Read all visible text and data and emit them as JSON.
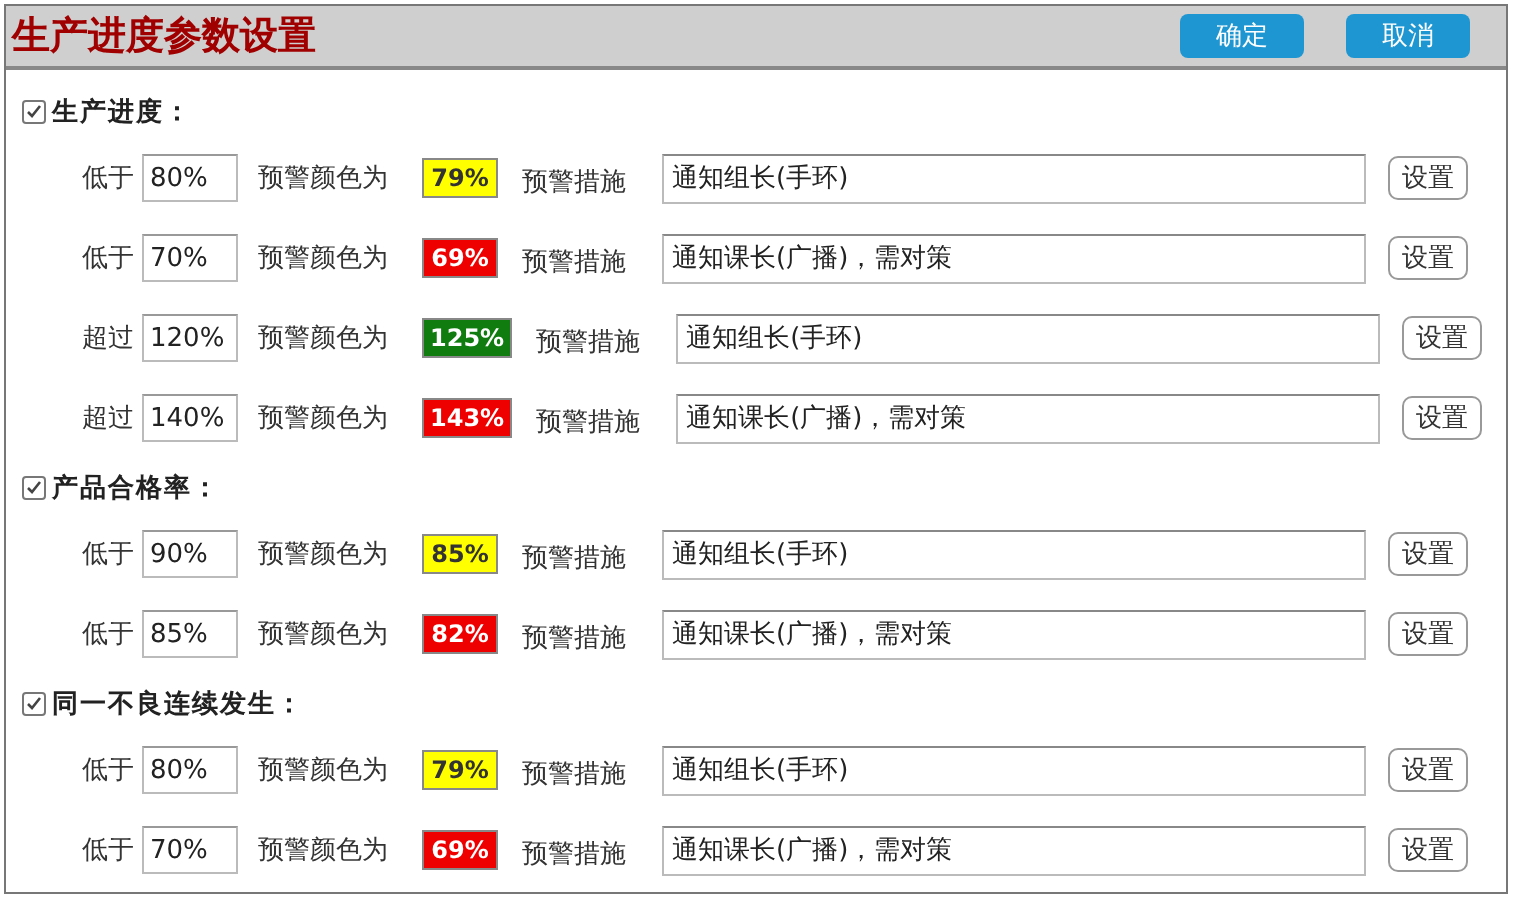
{
  "window": {
    "title": "生产进度参数设置",
    "buttons": [
      "确定",
      "取消"
    ]
  },
  "sections": [
    {
      "title": "生产进度：",
      "checked": true,
      "rules": [
        {
          "condition": "低于",
          "threshold": "80%",
          "color_label": "预警颜色为",
          "sample": "79%",
          "color": "#ffff00",
          "action_label": "预警措施",
          "action": "通知组长(手环)",
          "button": "设置"
        },
        {
          "condition": "低于",
          "threshold": "70%",
          "color_label": "预警颜色为",
          "sample": "69%",
          "color": "#ee0000",
          "action_label": "预警措施",
          "action": "通知课长(广播)，需对策",
          "button": "设置"
        },
        {
          "condition": "超过",
          "threshold": "120%",
          "color_label": "预警颜色为",
          "sample": "125%",
          "color": "#107c10",
          "action_label": "预警措施",
          "action": "通知组长(手环)",
          "button": "设置"
        },
        {
          "condition": "超过",
          "threshold": "140%",
          "color_label": "预警颜色为",
          "sample": "143%",
          "color": "#ee0000",
          "action_label": "预警措施",
          "action": "通知课长(广播)，需对策",
          "button": "设置"
        }
      ]
    },
    {
      "title": "产品合格率：",
      "checked": true,
      "rules": [
        {
          "condition": "低于",
          "threshold": "90%",
          "color_label": "预警颜色为",
          "sample": "85%",
          "color": "#ffff00",
          "action_label": "预警措施",
          "action": "通知组长(手环)",
          "button": "设置"
        },
        {
          "condition": "低于",
          "threshold": "85%",
          "color_label": "预警颜色为",
          "sample": "82%",
          "color": "#ee0000",
          "action_label": "预警措施",
          "action": "通知课长(广播)，需对策",
          "button": "设置"
        }
      ]
    },
    {
      "title": "同一不良连续发生：",
      "checked": true,
      "rules": [
        {
          "condition": "低于",
          "threshold": "80%",
          "color_label": "预警颜色为",
          "sample": "79%",
          "color": "#ffff00",
          "action_label": "预警措施",
          "action": "通知组长(手环)",
          "button": "设置"
        },
        {
          "condition": "低于",
          "threshold": "70%",
          "color_label": "预警颜色为",
          "sample": "69%",
          "color": "#ee0000",
          "action_label": "预警措施",
          "action": "通知课长(广播)，需对策",
          "button": "设置"
        }
      ]
    }
  ]
}
